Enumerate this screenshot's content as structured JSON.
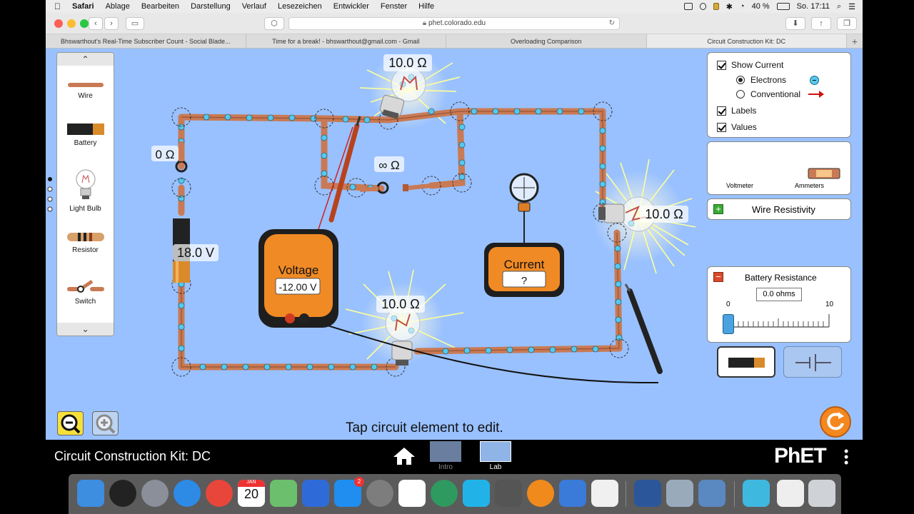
{
  "menubar": {
    "app_name": "Safari",
    "items": [
      "Ablage",
      "Bearbeiten",
      "Darstellung",
      "Verlauf",
      "Lesezeichen",
      "Entwickler",
      "Fenster",
      "Hilfe"
    ],
    "battery": "40 %",
    "clock": "So. 17:11"
  },
  "browser": {
    "url": "phet.colorado.edu",
    "tabs": [
      "Bhswarthout's Real-Time Subscriber Count - Social Blade...",
      "Time for a break! - bhswarthout@gmail.com - Gmail",
      "Overloading Comparison",
      "Circuit Construction Kit: DC"
    ],
    "active_tab_index": 3
  },
  "toolbox": {
    "items": [
      "Wire",
      "Battery",
      "Light Bulb",
      "Resistor",
      "Switch"
    ]
  },
  "circuit": {
    "bulb_top_label": "10.0 Ω",
    "bulb_right_label": "10.0 Ω",
    "bulb_bottom_label": "10.0 Ω",
    "switch_closed_label": "0 Ω",
    "switch_open_label": "∞ Ω",
    "battery_label": "18.0 V"
  },
  "voltmeter": {
    "title": "Voltage",
    "reading": "-12.00 V"
  },
  "ammeter": {
    "title": "Current",
    "reading": "?"
  },
  "controls": {
    "show_current": "Show Current",
    "electrons": "Electrons",
    "conventional": "Conventional",
    "labels": "Labels",
    "values": "Values",
    "current_mode": "electrons"
  },
  "sensors": {
    "voltmeter": "Voltmeter",
    "ammeters": "Ammeters"
  },
  "wire_resistivity": "Wire Resistivity",
  "battery_resistance": {
    "title": "Battery Resistance",
    "value": "0.0 ohms",
    "min": "0",
    "max": "10",
    "level": 0
  },
  "hint": "Tap circuit element to edit.",
  "navbar": {
    "title": "Circuit Construction Kit: DC",
    "screens": [
      "Intro",
      "Lab"
    ],
    "active_screen": "Lab",
    "brand": "PhET"
  },
  "dock": {
    "calendar_month": "JAN",
    "calendar_day": "20",
    "appstore_badge": "2",
    "icons": [
      "finder-icon",
      "siri-icon",
      "launchpad-icon",
      "safari-icon",
      "chrome-icon",
      "calendar-icon",
      "maps-icon",
      "keynote-icon",
      "app-store-icon",
      "system-preferences-icon",
      "screen-recorder-icon",
      "atom-icon",
      "codeshot-icon",
      "photo-booth-icon",
      "books-icon",
      "xcode-icon",
      "preview-icon",
      "word-icon",
      "sketch-icon",
      "photos-icon",
      "downloads-icon",
      "webloc-icon",
      "trash-icon"
    ]
  }
}
